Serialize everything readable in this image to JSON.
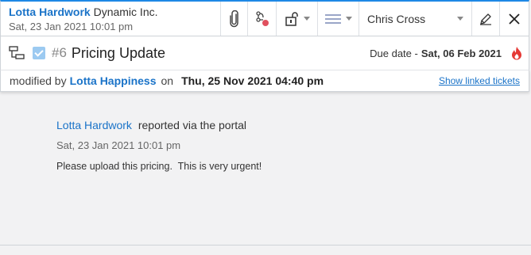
{
  "requester": {
    "name": "Lotta Hardwork",
    "company": "Dynamic Inc.",
    "date": "Sat, 23 Jan 2021 10:01 pm"
  },
  "toolbar": {
    "icons": [
      "paperclip-icon",
      "merge-icon",
      "lock-icon",
      "priority-icon",
      "edit-icon",
      "close-icon"
    ],
    "agent": "Chris Cross"
  },
  "ticket": {
    "number": "#6",
    "subject": "Pricing Update",
    "due_label": "Due date -",
    "due_date": "Sat, 06 Feb 2021"
  },
  "modified": {
    "prefix": "modified by",
    "by": "Lotta Happiness",
    "on": "on",
    "when": "Thu, 25 Nov 2021 04:40 pm",
    "linked": "Show linked tickets"
  },
  "message": {
    "author": "Lotta Hardwork",
    "via": "reported via the portal",
    "time": "Sat, 23 Jan 2021 10:01 pm",
    "body": "Please upload this pricing.  This is very urgent!"
  },
  "colors": {
    "accent": "#1a73c8",
    "fire": "#e53935"
  }
}
